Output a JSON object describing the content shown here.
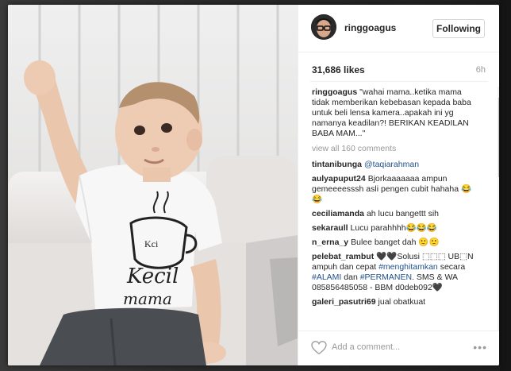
{
  "post": {
    "username": "ringgoagus",
    "follow_label": "Following",
    "likes": "31,686 likes",
    "time": "6h"
  },
  "comments": [
    {
      "user": "ringgoagus",
      "text": "\"wahai mama..ketika mama tidak memberikan kebebasan kepada baba untuk beli lensa kamera..apakah ini yg namanya keadilan?! BERIKAN KEADILAN BABA MAM...\""
    },
    {
      "user": "tintanibunga",
      "text": "",
      "mention": "@taqiarahman"
    },
    {
      "user": "aulyapuput24",
      "text": "Bjorkaaaaaaa ampun gemeeeesssh asli pengen cubit hahaha 😂😂"
    },
    {
      "user": "ceciliamanda",
      "text": "ah lucu bangettt sih"
    },
    {
      "user": "sekaraull",
      "text": "Lucu parahhhh😂😂😂"
    },
    {
      "user": "n_erna_y",
      "text": "Bulee banget dah 🙂🙂"
    },
    {
      "user": "pelebat_rambut",
      "text_parts": [
        "🖤🖤Solusi ⬚⬚⬚ UB⬚N ampuh dan cepat ",
        "#menghitamkan",
        " secara ",
        "#ALAMI",
        " dan ",
        "#PERMANEN",
        ". SMS & WA 085856485058 - BBM d0deb092🖤"
      ]
    },
    {
      "user": "galeri_pasutri69",
      "text": "jual obatkuat"
    }
  ],
  "view_all_label": "view all 160 comments",
  "footer": {
    "add_comment_placeholder": "Add a comment...",
    "more_label": "•••"
  },
  "photo": {
    "shirt_text_line1": "Kecil",
    "shirt_text_line2": "mama",
    "cup_text": "Kci"
  },
  "colors": {
    "link": "#1f4f8a",
    "muted": "#999999",
    "text": "#262626"
  },
  "icons": [
    "heart-icon",
    "more-options-icon",
    "scroll-up-icon",
    "scroll-down-icon"
  ]
}
